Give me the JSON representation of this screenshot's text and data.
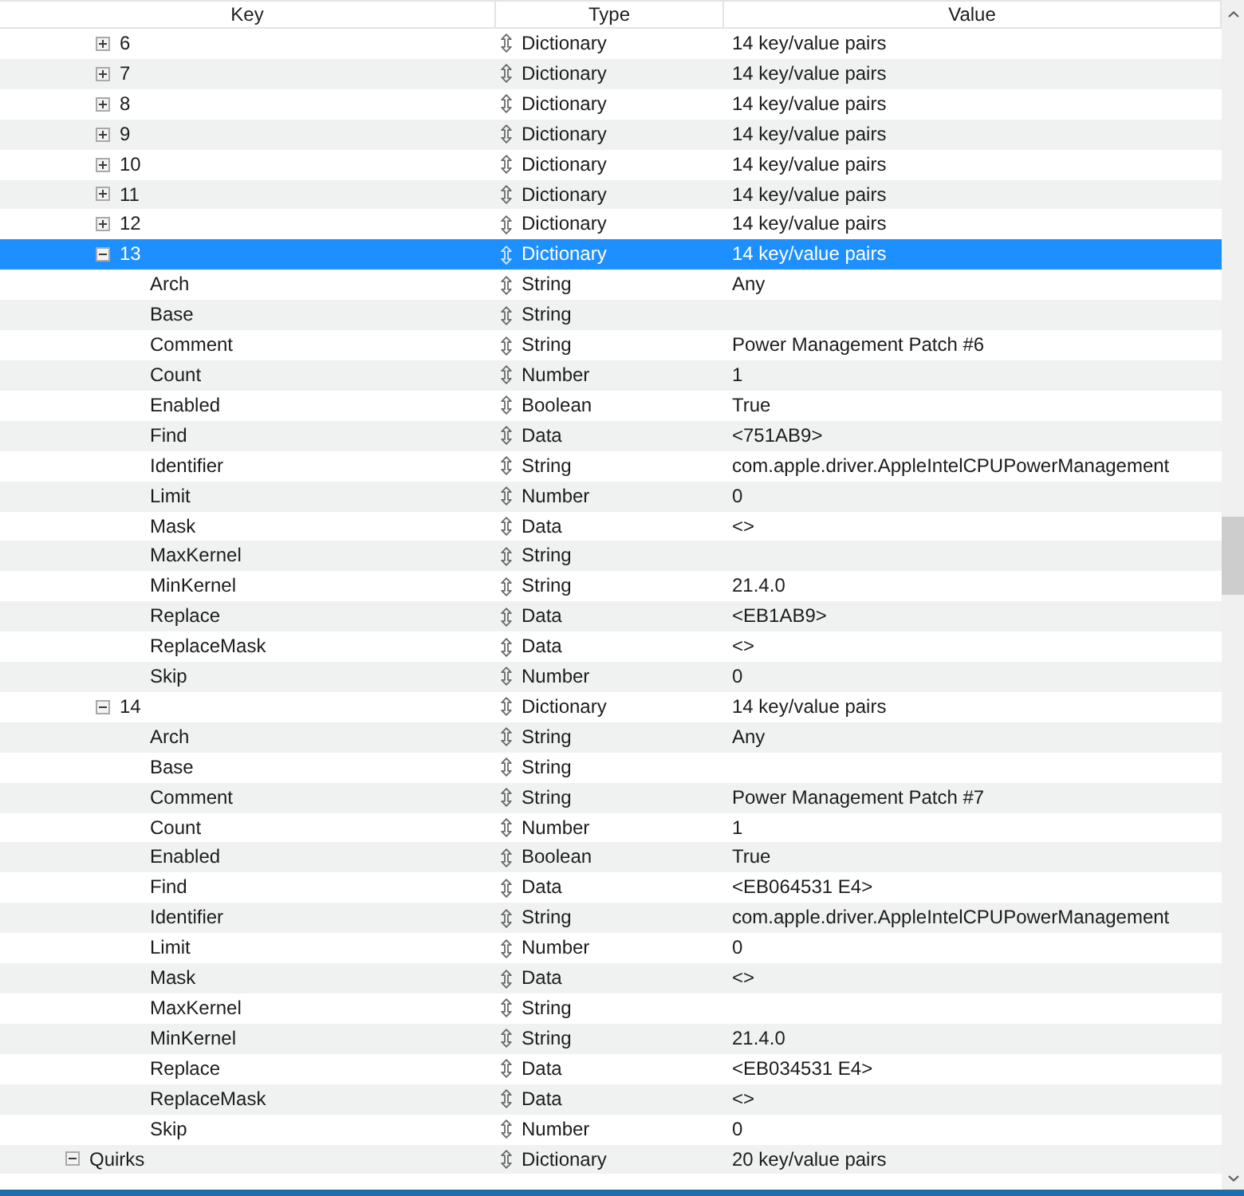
{
  "columns": [
    "Key",
    "Type",
    "Value"
  ],
  "tree": [
    {
      "children": [
        {
          "key": "6",
          "type": "Dictionary",
          "value": "14 key/value pairs",
          "expanded": false,
          "selected": false
        },
        {
          "key": "7",
          "type": "Dictionary",
          "value": "14 key/value pairs",
          "expanded": false,
          "selected": false
        },
        {
          "key": "8",
          "type": "Dictionary",
          "value": "14 key/value pairs",
          "expanded": false,
          "selected": false
        },
        {
          "key": "9",
          "type": "Dictionary",
          "value": "14 key/value pairs",
          "expanded": false,
          "selected": false
        },
        {
          "key": "10",
          "type": "Dictionary",
          "value": "14 key/value pairs",
          "expanded": false,
          "selected": false
        },
        {
          "key": "11",
          "type": "Dictionary",
          "value": "14 key/value pairs",
          "expanded": false,
          "selected": false
        },
        {
          "key": "12",
          "type": "Dictionary",
          "value": "14 key/value pairs",
          "expanded": false,
          "selected": false
        },
        {
          "key": "13",
          "type": "Dictionary",
          "value": "14 key/value pairs",
          "expanded": true,
          "selected": true,
          "children": [
            {
              "key": "Arch",
              "type": "String",
              "value": "Any",
              "selected": false
            },
            {
              "key": "Base",
              "type": "String",
              "selected": false
            },
            {
              "key": "Comment",
              "type": "String",
              "value": "Power Management Patch #6",
              "selected": false
            },
            {
              "key": "Count",
              "type": "Number",
              "value": "1",
              "selected": false
            },
            {
              "key": "Enabled",
              "type": "Boolean",
              "value": "True",
              "selected": false
            },
            {
              "key": "Find",
              "type": "Data",
              "value": "<751AB9>",
              "selected": false
            },
            {
              "key": "Identifier",
              "type": "String",
              "value": "com.apple.driver.AppleIntelCPUPowerManagement",
              "selected": false
            },
            {
              "key": "Limit",
              "type": "Number",
              "value": "0",
              "selected": false
            },
            {
              "key": "Mask",
              "type": "Data",
              "value": "<>",
              "selected": false
            },
            {
              "key": "MaxKernel",
              "type": "String",
              "selected": false
            },
            {
              "key": "MinKernel",
              "type": "String",
              "value": "21.4.0",
              "selected": false
            },
            {
              "key": "Replace",
              "type": "Data",
              "value": "<EB1AB9>",
              "selected": false
            },
            {
              "key": "ReplaceMask",
              "type": "Data",
              "value": "<>",
              "selected": false
            },
            {
              "key": "Skip",
              "type": "Number",
              "value": "0",
              "selected": false
            }
          ]
        },
        {
          "key": "14",
          "type": "Dictionary",
          "value": "14 key/value pairs",
          "expanded": true,
          "selected": false,
          "children": [
            {
              "key": "Arch",
              "type": "String",
              "value": "Any",
              "selected": false
            },
            {
              "key": "Base",
              "type": "String",
              "selected": false
            },
            {
              "key": "Comment",
              "type": "String",
              "value": "Power Management Patch #7",
              "selected": false
            },
            {
              "key": "Count",
              "type": "Number",
              "value": "1",
              "selected": false
            },
            {
              "key": "Enabled",
              "type": "Boolean",
              "value": "True",
              "selected": false
            },
            {
              "key": "Find",
              "type": "Data",
              "value": "<EB064531 E4>",
              "selected": false
            },
            {
              "key": "Identifier",
              "type": "String",
              "value": "com.apple.driver.AppleIntelCPUPowerManagement",
              "selected": false
            },
            {
              "key": "Limit",
              "type": "Number",
              "value": "0",
              "selected": false
            },
            {
              "key": "Mask",
              "type": "Data",
              "value": "<>",
              "selected": false
            },
            {
              "key": "MaxKernel",
              "type": "String",
              "selected": false
            },
            {
              "key": "MinKernel",
              "type": "String",
              "value": "21.4.0",
              "selected": false
            },
            {
              "key": "Replace",
              "type": "Data",
              "value": "<EB034531 E4>",
              "selected": false
            },
            {
              "key": "ReplaceMask",
              "type": "Data",
              "value": "<>",
              "selected": false
            },
            {
              "key": "Skip",
              "type": "Number",
              "value": "0",
              "selected": false
            }
          ]
        }
      ]
    },
    {
      "key": "Quirks",
      "type": "Dictionary",
      "value": "20 key/value pairs",
      "expanded": true,
      "selected": false
    }
  ]
}
